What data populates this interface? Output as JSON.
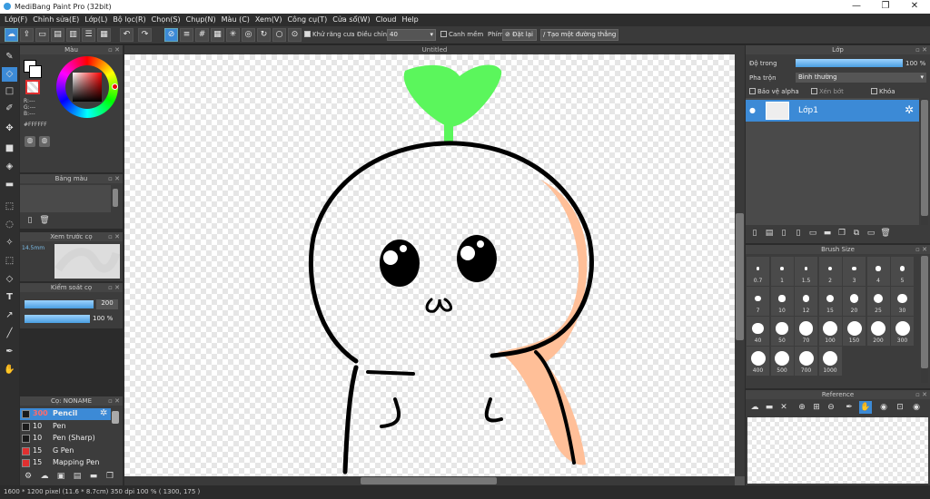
{
  "window": {
    "title": "MediBang Paint Pro (32bit)",
    "minimize": "—",
    "restore": "❐",
    "close": "✕"
  },
  "menu": [
    "Lớp(F)",
    "Chỉnh sửa(E)",
    "Lớp(L)",
    "Bộ lọc(R)",
    "Chọn(S)",
    "Chụp(N)",
    "Màu (C)",
    "Xem(V)",
    "Công cụ(T)",
    "Cửa sổ(W)",
    "Cloud",
    "Help"
  ],
  "toolbar": {
    "antialias_label": "Khử răng cưa",
    "adjust_label": "Điều chỉnh",
    "adjust_value": "40",
    "snap_label": "Canh mềm",
    "key_label": "Phím",
    "reset_label": "Đặt lại",
    "line_label": "Tạo một đường thẳng"
  },
  "color_panel": {
    "title": "Màu",
    "r": "R:---",
    "g": "G:---",
    "b": "B:---",
    "hex": "#FFFFFF"
  },
  "palette_panel": {
    "title": "Bảng màu"
  },
  "preview_panel": {
    "title": "Xem trước cọ",
    "size": "14.5mm"
  },
  "brush_control": {
    "title": "Kiểm soát cọ",
    "size": "200",
    "opacity": "100 %"
  },
  "brush_list": {
    "title": "Cọ: NONAME",
    "items": [
      {
        "size": "300",
        "name": "Pencil",
        "color": "#1a1a1a",
        "selected": true
      },
      {
        "size": "10",
        "name": "Pen",
        "color": "#1a1a1a"
      },
      {
        "size": "10",
        "name": "Pen (Sharp)",
        "color": "#1a1a1a"
      },
      {
        "size": "15",
        "name": "G Pen",
        "color": "#e03030"
      },
      {
        "size": "15",
        "name": "Mapping Pen",
        "color": "#e03030"
      }
    ]
  },
  "canvas": {
    "title": "Untitled"
  },
  "layer_panel": {
    "title": "Lớp",
    "opacity_label": "Độ trong",
    "opacity_value": "100 %",
    "opacity_fraction": 1.0,
    "blend_label": "Pha trộn",
    "blend_value": "Bình thường",
    "protect_alpha": "Bảo vệ alpha",
    "clipping": "Xén bớt",
    "lock": "Khóa",
    "layer_name": "Lớp1"
  },
  "brush_size": {
    "title": "Brush Size",
    "sizes": [
      "0.7",
      "1",
      "1.5",
      "2",
      "3",
      "4",
      "5",
      "7",
      "10",
      "12",
      "15",
      "20",
      "25",
      "30",
      "40",
      "50",
      "70",
      "100",
      "150",
      "200",
      "300",
      "400",
      "500",
      "700",
      "1000"
    ]
  },
  "reference": {
    "title": "Reference"
  },
  "status": "1600 * 1200 pixel   (11.6 * 8.7cm)   350 dpi   100 %   ( 1300, 175 )"
}
